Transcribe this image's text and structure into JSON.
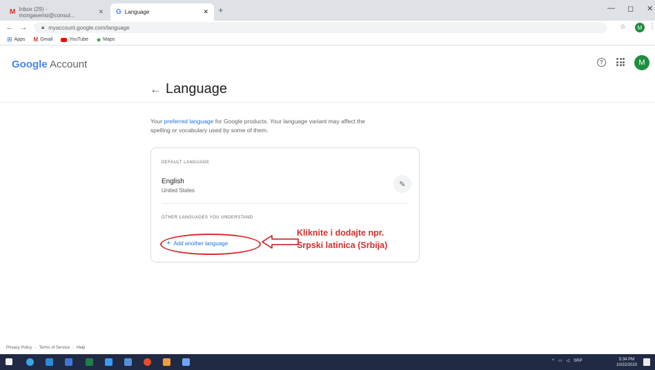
{
  "browser": {
    "tabs": [
      {
        "label": "Inbox (29) - mongaverisi@consul...",
        "icon": "gmail-icon"
      },
      {
        "label": "Language",
        "icon": "google-icon"
      }
    ],
    "url": "myaccount.google.com/language",
    "profile_initial": "M",
    "bookmarks": [
      {
        "label": "Apps",
        "icon": "apps-grid-icon"
      },
      {
        "label": "Gmail",
        "icon": "gmail-icon"
      },
      {
        "label": "YouTube",
        "icon": "youtube-icon"
      },
      {
        "label": "Maps",
        "icon": "maps-icon"
      }
    ]
  },
  "header": {
    "brand_google": "Google",
    "brand_account": "Account",
    "avatar_initial": "M"
  },
  "page": {
    "title": "Language",
    "desc_pre": "Your ",
    "desc_link": "preferred language",
    "desc_post": " for Google products. Your language variant may affect the spelling or vocabulary used by some of them."
  },
  "card": {
    "default_label": "DEFAULT LANGUAGE",
    "language": "English",
    "region": "United States",
    "other_label": "OTHER LANGUAGES YOU UNDERSTAND",
    "add_button": "Add another language"
  },
  "annotation": {
    "line1": "Kliknite i dodajte npr.",
    "line2": "Srpski latinica (Srbija)",
    "color": "#d32f2f"
  },
  "footer": {
    "links": [
      "Privacy Policy",
      "Terms of Service",
      "Help"
    ],
    "separator": "·"
  },
  "taskbar": {
    "lang": "SRP",
    "time": "5:34 PM",
    "date": "10/22/2020"
  }
}
